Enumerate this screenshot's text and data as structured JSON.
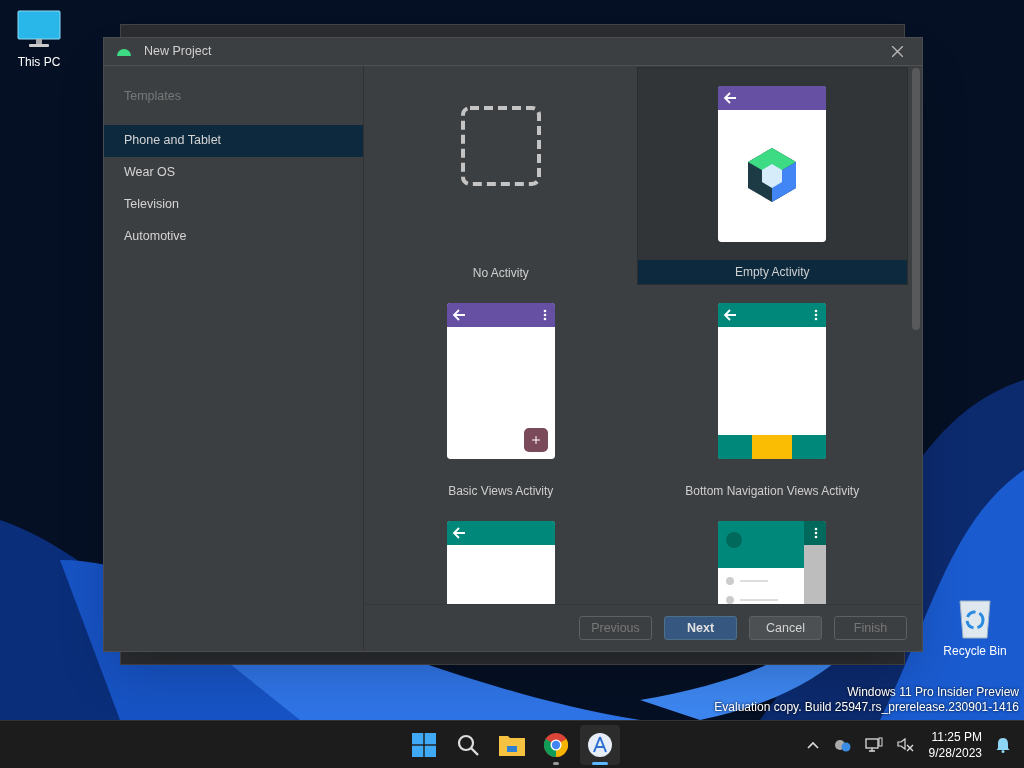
{
  "desktop_icons": [
    {
      "kind": "pc",
      "label": "This PC"
    },
    {
      "kind": "bin",
      "label": "Recycle Bin"
    }
  ],
  "dialog": {
    "title": "New Project",
    "sidebar": {
      "header": "Templates",
      "items": [
        {
          "label": "Phone and Tablet",
          "selected": true
        },
        {
          "label": "Wear OS",
          "selected": false
        },
        {
          "label": "Television",
          "selected": false
        },
        {
          "label": "Automotive",
          "selected": false
        }
      ]
    },
    "templates": [
      {
        "kind": "none",
        "label": "No Activity",
        "selected": false
      },
      {
        "kind": "empty",
        "label": "Empty Activity",
        "selected": true
      },
      {
        "kind": "basic",
        "label": "Basic Views Activity",
        "selected": false
      },
      {
        "kind": "bottom_nav",
        "label": "Bottom Navigation Views Activity",
        "selected": false
      },
      {
        "kind": "teal_bar",
        "selected": false
      },
      {
        "kind": "drawer",
        "selected": false
      }
    ],
    "buttons": [
      {
        "label": "Previous",
        "primary": false,
        "disabled": true
      },
      {
        "label": "Next",
        "primary": true,
        "disabled": false
      },
      {
        "label": "Cancel",
        "primary": false,
        "disabled": false
      },
      {
        "label": "Finish",
        "primary": false,
        "disabled": true
      }
    ]
  },
  "edition_notice": [
    "Windows 11 Pro Insider Preview",
    "Evaluation copy. Build 25947.rs_prerelease.230901-1416"
  ],
  "taskbar": {
    "apps": [
      {
        "kind": "start",
        "selected": false,
        "running": false
      },
      {
        "kind": "search",
        "selected": false,
        "running": false
      },
      {
        "kind": "files",
        "selected": false,
        "running": false
      },
      {
        "kind": "browser",
        "selected": false,
        "running": true
      },
      {
        "kind": "studio",
        "selected": true,
        "running": true
      }
    ],
    "time": "11:25 PM",
    "date": "9/28/2023"
  }
}
